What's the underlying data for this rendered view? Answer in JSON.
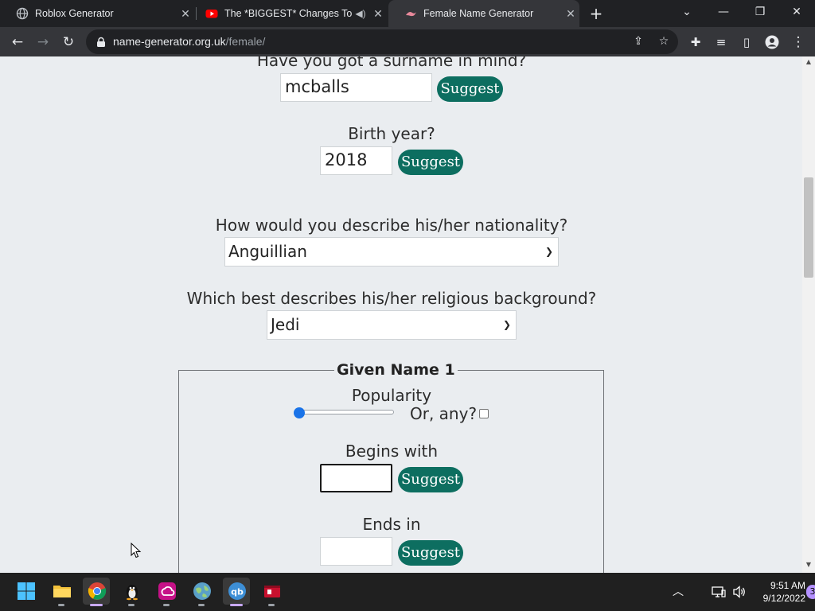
{
  "browser": {
    "tabs": [
      {
        "label": "Roblox Generator",
        "icon": "globe-icon"
      },
      {
        "label": "The *BIGGEST* Changes To N",
        "icon": "youtube-icon"
      },
      {
        "label": "Female Name Generator",
        "icon": "site-favicon"
      }
    ],
    "new_tab": "+",
    "url_host": "name-generator.org.uk",
    "url_path": "/female/"
  },
  "form": {
    "surname_label": "Have you got a surname in mind?",
    "surname_value": "mcballs",
    "birth_year_label": "Birth year?",
    "birth_year_value": "2018",
    "nationality_label": "How would you describe his/her nationality?",
    "nationality_value": "Anguillian",
    "religion_label": "Which best describes his/her religious background?",
    "religion_value": "Jedi",
    "suggest_label": "Suggest",
    "given_name": {
      "legend": "Given Name 1",
      "popularity_label": "Popularity",
      "popularity_level": 0,
      "or_any_label": "Or, any?",
      "begins_with_label": "Begins with",
      "begins_with_value": "",
      "ends_in_label": "Ends in",
      "ends_in_value": ""
    }
  },
  "taskbar": {
    "time": "9:51 AM",
    "date": "9/12/2022",
    "notification_count": "3"
  },
  "colors": {
    "suggest_button": "#0d6e60",
    "page_background": "#eaedf0",
    "slider_thumb": "#1a73e8"
  }
}
